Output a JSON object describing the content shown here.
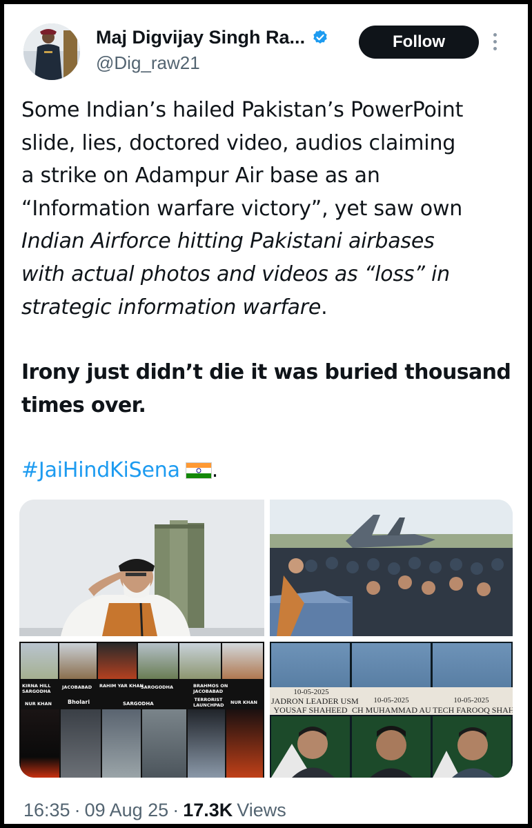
{
  "author": {
    "display_name": "Maj Digvijay Singh Ra...",
    "handle": "@Dig_raw21",
    "verified": true,
    "verified_color": "#1d9bf0"
  },
  "actions": {
    "follow_label": "Follow"
  },
  "tweet": {
    "lines": [
      "Some Indian’s hailed Pakistan’s PowerPoint",
      "slide, lies, doctored video, audios claiming",
      "a strike on Adampur Air base as an",
      "“Information warfare victory”,  yet saw own"
    ],
    "italic_lines": [
      "Indian Airforce hitting Pakistani airbases",
      "with actual photos and videos as “loss” in",
      "strategic information warfare"
    ],
    "italic_tail": ".",
    "bold_lines": [
      "Irony just didn’t die it was buried thousand",
      "times over."
    ],
    "hashtag": "#JaiHindKiSena",
    "hashtag_tail": ".",
    "hashtag_color": "#1d9bf0"
  },
  "media": {
    "strike_captions": [
      "KIRNA HILL SARGODHA",
      "JACOBABAD",
      "RAHIM YAR KHAN",
      "SAROGODHA",
      "BRAHMOS ON JACOBABAD",
      "NUR KHAN",
      "Bholari",
      "SARGODHA",
      "TERRORIST LAUNCHPAD",
      "NUR KHAN"
    ],
    "memorial_dates": [
      "10-05-2025",
      "10-05-2025",
      "10-05-2025"
    ],
    "memorial_names": [
      "JADRON LEADER USM",
      "YOUSAF SHAHEED",
      "CH MUHAMMAD AU",
      "TECH FAROOQ SHAHI"
    ]
  },
  "meta": {
    "time": "16:35",
    "date": "09 Aug 25",
    "views_count": "17.3K",
    "views_label": "Views",
    "separator": "·"
  }
}
